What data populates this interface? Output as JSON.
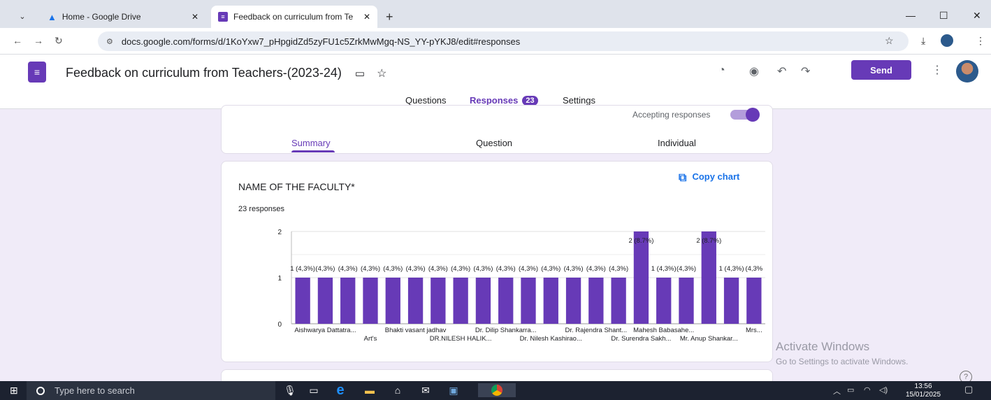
{
  "browser": {
    "tabs": [
      {
        "title": "Home - Google Drive",
        "active": false
      },
      {
        "title": "Feedback on curriculum from Te",
        "active": true
      }
    ],
    "url": "docs.google.com/forms/d/1KoYxw7_pHpgidZd5zyFU1c5ZrkMwMgq-NS_YY-pYKJ8/edit#responses"
  },
  "forms_header": {
    "title": "Feedback on curriculum from Teachers-(2023-24)",
    "send_label": "Send",
    "tabs": [
      {
        "label": "Questions"
      },
      {
        "label": "Responses",
        "badge": "23"
      },
      {
        "label": "Settings"
      }
    ]
  },
  "summary_card": {
    "accepting_label": "Accepting responses",
    "accepting": true,
    "subtabs": [
      "Summary",
      "Question",
      "Individual"
    ]
  },
  "question_card": {
    "copy_label": "Copy chart",
    "title": "NAME OF THE FACULTY*",
    "responses_label": "23 responses"
  },
  "chart_data": {
    "type": "bar",
    "ylim": [
      0,
      2
    ],
    "yticks": [
      0,
      1,
      2
    ],
    "bar_color": "#673ab7",
    "grid": true,
    "values": [
      1,
      1,
      1,
      1,
      1,
      1,
      1,
      1,
      1,
      1,
      1,
      1,
      1,
      1,
      1,
      2,
      1,
      1,
      2,
      1,
      1
    ],
    "data_labels": [
      "1 (4,3%)",
      "(4,3%)",
      "(4,3%)",
      "(4,3%)",
      "(4,3%)",
      "(4,3%)",
      "(4,3%)",
      "(4,3%)",
      "(4,3%)",
      "(4,3%)",
      "(4,3%)",
      "(4,3%)",
      "(4,3%)",
      "(4,3%)",
      "(4,3%)",
      "2 (8.7%)",
      "1 (4,3%)",
      "(4,3%)",
      "2 (8.7%)",
      "1 (4,3%)",
      "(4,3%"
    ],
    "x_labels_row1": [
      {
        "text": "Aishwarya Dattatra...",
        "index": 1
      },
      {
        "text": "Bhakti vasant jadhav",
        "index": 5
      },
      {
        "text": "Dr. Dilip Shankarra...",
        "index": 9
      },
      {
        "text": "Dr. Rajendra Shant...",
        "index": 13
      },
      {
        "text": "Mahesh Babasahe...",
        "index": 16
      },
      {
        "text": "Mrs...",
        "index": 20
      }
    ],
    "x_labels_row2": [
      {
        "text": "Art's",
        "index": 3
      },
      {
        "text": "DR.NILESH HALIK...",
        "index": 7
      },
      {
        "text": "Dr. Nilesh Kashirao...",
        "index": 11
      },
      {
        "text": "Dr. Surendra Sakh...",
        "index": 15
      },
      {
        "text": "Mr. Anup Shankar...",
        "index": 18
      }
    ]
  },
  "overlay": {
    "activate_title": "Activate Windows",
    "activate_sub": "Go to Settings to activate Windows."
  },
  "taskbar": {
    "search_placeholder": "Type here to search",
    "time": "13:56",
    "date": "15/01/2025"
  }
}
